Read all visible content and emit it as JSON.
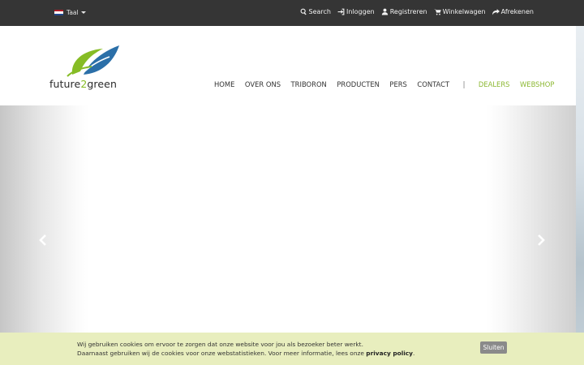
{
  "topbar": {
    "language_label": "Taal",
    "links": [
      {
        "label": "Search",
        "icon": "search-icon"
      },
      {
        "label": "Inloggen",
        "icon": "sign-in-icon"
      },
      {
        "label": "Registreren",
        "icon": "user-icon"
      },
      {
        "label": "Winkelwagen",
        "icon": "shopping-cart-icon"
      },
      {
        "label": "Afrekenen",
        "icon": "share-arrow-icon"
      }
    ]
  },
  "logo": {
    "part1": "future",
    "part2": "2",
    "part3": "green"
  },
  "nav": {
    "items": [
      "HOME",
      "OVER ONS",
      "TRIBORON",
      "PRODUCTEN",
      "PERS",
      "CONTACT"
    ],
    "separator": "|",
    "dealers": "DEALERS",
    "webshop": "WEBSHOP"
  },
  "cookie": {
    "line1": "Wij gebruiken cookies om ervoor te zorgen dat onze website voor jou als bezoeker beter werkt.",
    "line2": "Daarnaast gebruiken wij de cookies voor onze webstatistieken. Voor meer informatie, lees onze ",
    "link": "privacy policy",
    "end": ".",
    "button": "Sluiten"
  },
  "colors": {
    "topbar": "#353535",
    "accent_green": "#8cb832",
    "logo_blue": "#2b6fa8",
    "cookie_bg": "#e8eebe"
  }
}
